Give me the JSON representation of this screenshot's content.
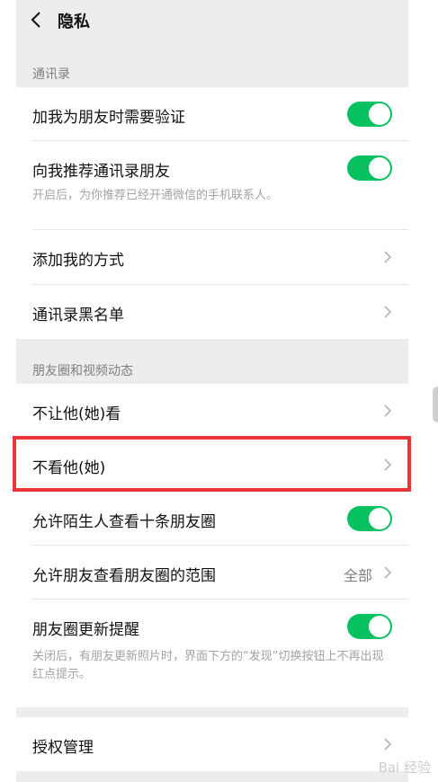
{
  "header": {
    "title": "隐私"
  },
  "sections": {
    "contacts": {
      "label": "通讯录",
      "verify": {
        "label": "加我为朋友时需要验证",
        "on": true
      },
      "recommend": {
        "label": "向我推荐通讯录朋友",
        "sub": "开启后，为你推荐已经开通微信的手机联系人。",
        "on": true
      },
      "add_methods": {
        "label": "添加我的方式"
      },
      "blacklist": {
        "label": "通讯录黑名单"
      }
    },
    "moments": {
      "label": "朋友圈和视频动态",
      "hide_from": {
        "label": "不让他(她)看"
      },
      "dont_see": {
        "label": "不看他(她)"
      },
      "stranger_ten": {
        "label": "允许陌生人查看十条朋友圈",
        "on": true
      },
      "range": {
        "label": "允许朋友查看朋友圈的范围",
        "value": "全部"
      },
      "update_notify": {
        "label": "朋友圈更新提醒",
        "sub": "关闭后，有朋友更新照片时，界面下方的“发现”切换按钮上不再出现红点提示。",
        "on": true
      }
    },
    "auth": {
      "label": "授权管理"
    }
  },
  "watermark": "Bai 经验",
  "colors": {
    "toggle_on": "#07c160",
    "highlight": "#e8363b"
  }
}
